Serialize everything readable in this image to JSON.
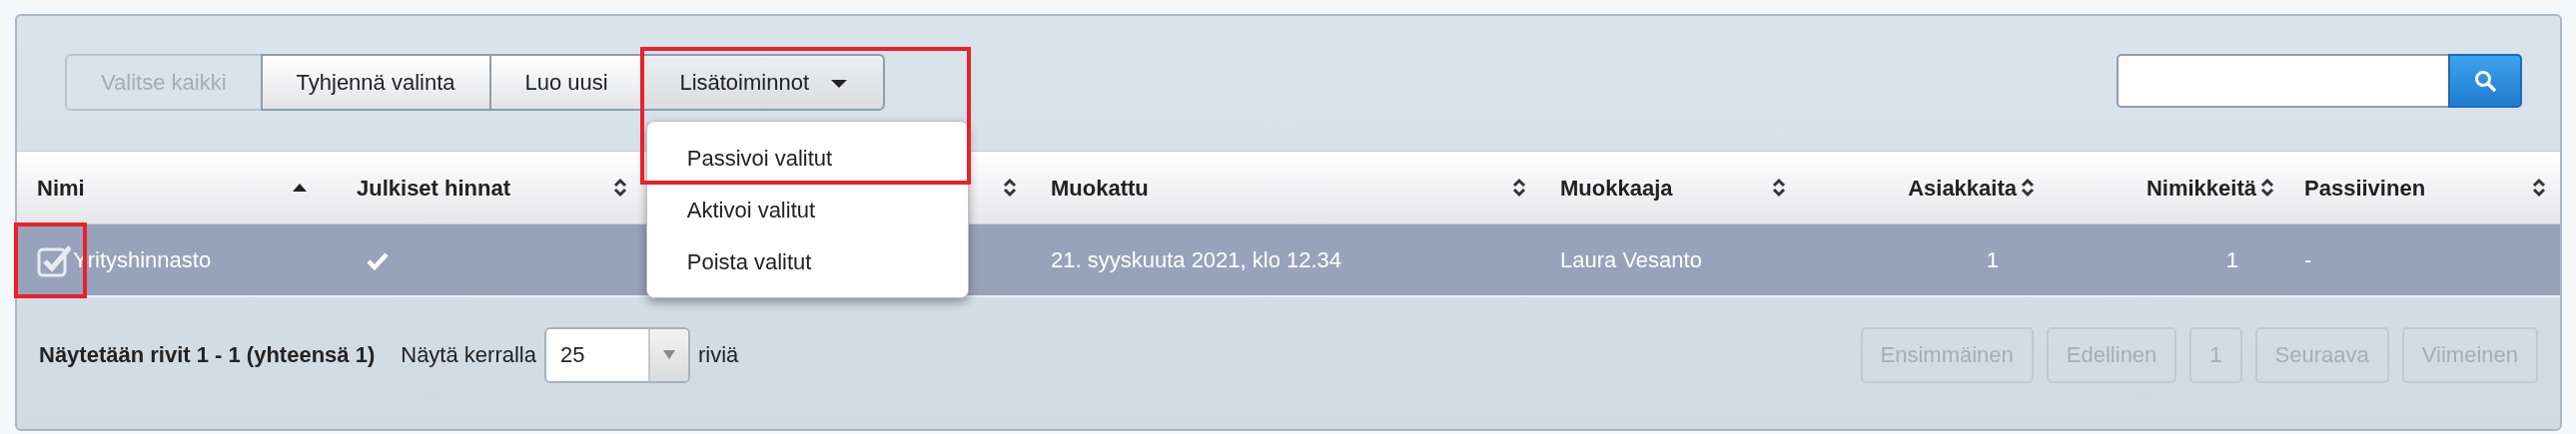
{
  "toolbar": {
    "buttons": [
      {
        "label": "Valitse kaikki",
        "disabled": true
      },
      {
        "label": "Tyhjennä valinta",
        "disabled": false
      },
      {
        "label": "Luo uusi",
        "disabled": false
      }
    ],
    "dropdown": {
      "label": "Lisätoiminnot",
      "expanded": true,
      "highlighted": true,
      "items": [
        {
          "label": "Passivoi valitut"
        },
        {
          "label": "Aktivoi valitut"
        },
        {
          "label": "Poista valitut"
        }
      ]
    }
  },
  "table": {
    "columns": [
      {
        "label": "Nimi",
        "sorted_ascending": true
      },
      {
        "label": "Julkiset hinnat",
        "sorted_ascending": false
      },
      {
        "sorted_ascending": false
      },
      {
        "label": "Muokattu",
        "sorted_ascending": false
      },
      {
        "label": "Muokkaaja",
        "sorted_ascending": false
      },
      {
        "label": "Asiakkaita",
        "sorted_ascending": false
      },
      {
        "label": "Nimikkeitä",
        "sorted_ascending": false
      },
      {
        "label": "Passiivinen",
        "sorted_ascending": false
      }
    ],
    "rows": [
      {
        "selected": true,
        "checkbox_highlighted": true,
        "name": "Yrityshinnasto",
        "public_prices": true,
        "modified": "21. syyskuuta 2021, klo 12.34",
        "modifier": "Laura Vesanto",
        "customers": "1",
        "items": "1",
        "passive": "-"
      }
    ]
  },
  "footer": {
    "summary": "Näytetään rivit 1 - 1 (yhteensä 1)",
    "page_size_label": "Näytä kerralla",
    "page_size": "25",
    "page_size_suffix": "riviä",
    "pagination": [
      {
        "label": "Ensimmäinen",
        "disabled": true
      },
      {
        "label": "Edellinen",
        "disabled": true
      },
      {
        "label": "1",
        "disabled": true
      },
      {
        "label": "Seuraava",
        "disabled": true
      },
      {
        "label": "Viimeinen",
        "disabled": true
      }
    ]
  }
}
